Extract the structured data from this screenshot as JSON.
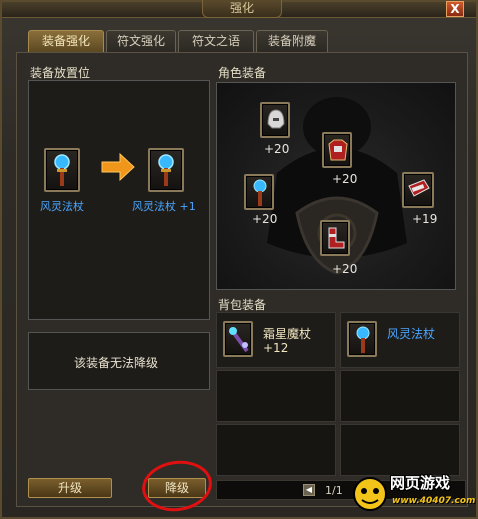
{
  "window": {
    "title": "强化",
    "close_label": "X"
  },
  "tabs": [
    {
      "label": "装备强化"
    },
    {
      "label": "符文强化"
    },
    {
      "label": "符文之语"
    },
    {
      "label": "装备附魔"
    }
  ],
  "left_panel": {
    "header": "装备放置位",
    "source_item": "风灵法杖",
    "result_item": "风灵法杖 +1",
    "message": "该装备无法降级"
  },
  "character": {
    "header": "角色装备",
    "slots": [
      {
        "icon": "helmet-icon",
        "value": "+20"
      },
      {
        "icon": "armor-icon",
        "value": "+20"
      },
      {
        "icon": "staff-icon",
        "value": "+20"
      },
      {
        "icon": "bracer-icon",
        "value": "+19"
      },
      {
        "icon": "boots-icon",
        "value": "+20"
      }
    ]
  },
  "bag": {
    "header": "背包装备",
    "items": [
      {
        "name": "霜星魔杖",
        "plus": "+12",
        "color": "#f0e6c0"
      },
      {
        "name": "风灵法杖",
        "plus": "",
        "color": "#4aa6ff"
      }
    ],
    "page": "1/1"
  },
  "buttons": {
    "upgrade": "升级",
    "downgrade": "降级"
  },
  "brand": {
    "line1": "网页游戏",
    "line2": "www.40407.com"
  },
  "colors": {
    "accent": "#a88a4e",
    "item_blue": "#4aa6ff",
    "highlight_circle": "#e01010"
  }
}
